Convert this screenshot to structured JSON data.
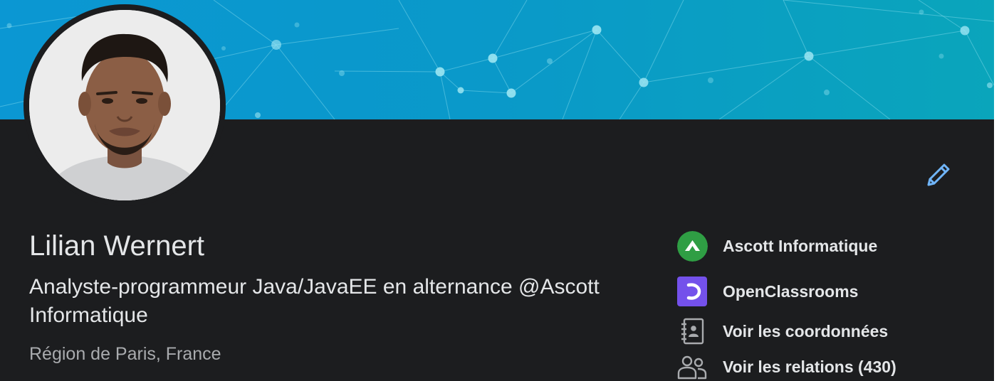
{
  "profile": {
    "name": "Lilian Wernert",
    "headline": "Analyste-programmeur Java/JavaEE en alternance @Ascott Informatique",
    "location": "Région de Paris, France"
  },
  "sidebar": {
    "items": [
      {
        "label": "Ascott Informatique",
        "icon": "ascott-logo-icon",
        "color": "#2f9e44"
      },
      {
        "label": "OpenClassrooms",
        "icon": "openclassrooms-logo-icon",
        "color": "#7451eb"
      },
      {
        "label": "Voir les coordonnées",
        "icon": "contact-book-icon"
      },
      {
        "label": "Voir les relations (430)",
        "icon": "people-icon"
      }
    ]
  },
  "actions": {
    "edit_icon": "pencil-icon"
  },
  "colors": {
    "background": "#1c1d1f",
    "banner_top": "#0a9bd6",
    "banner_bottom": "#0aa3bd",
    "text_primary": "#e4e6e8",
    "text_secondary": "#a9abae",
    "accent": "#70b5f9"
  }
}
